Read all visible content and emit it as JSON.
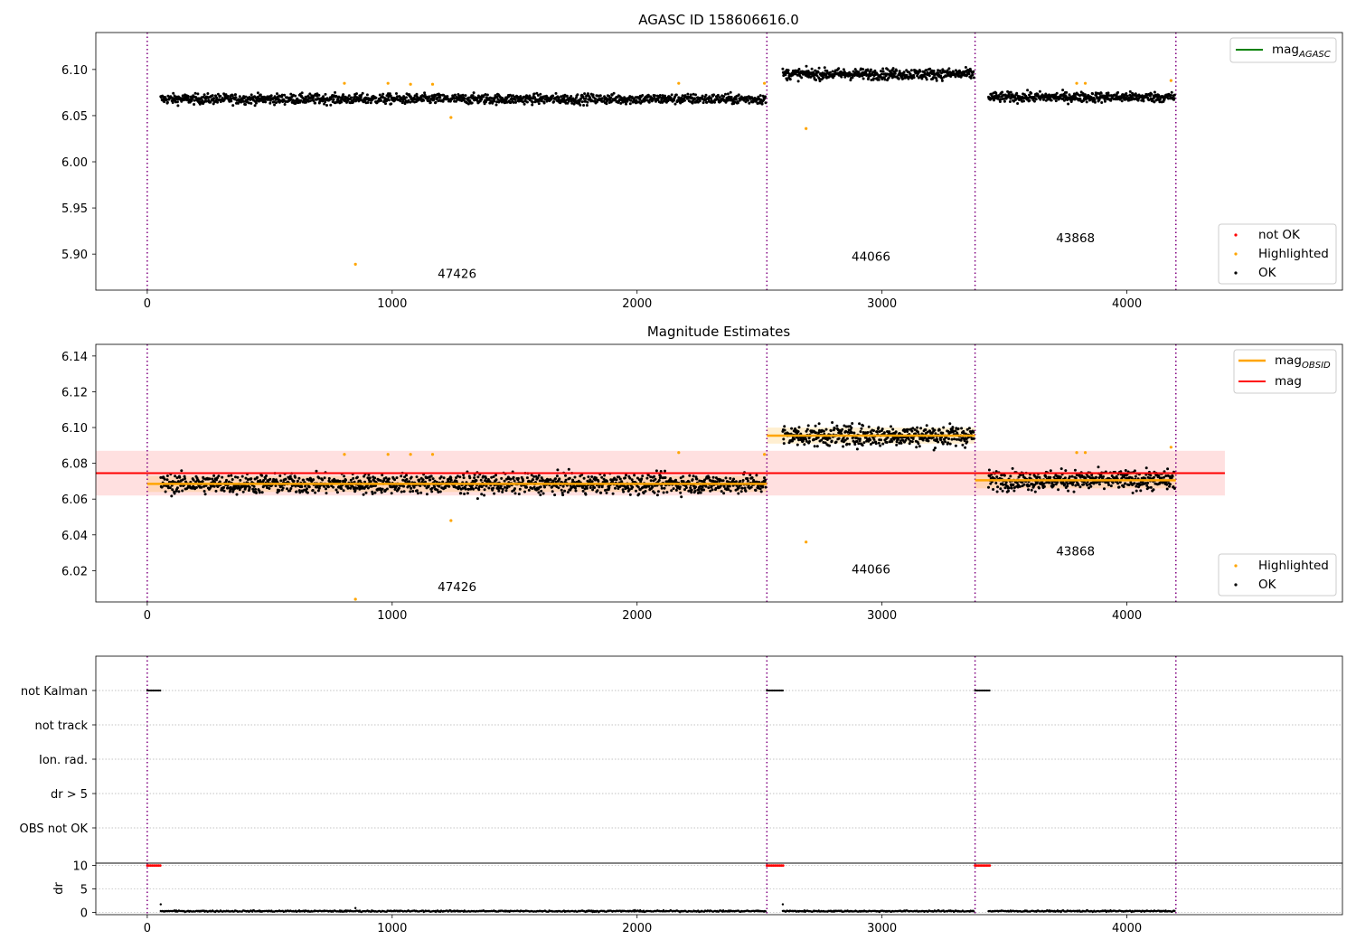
{
  "chart_data": [
    {
      "type": "scatter",
      "title": "AGASC ID 158606616.0",
      "xlim": [
        -210,
        4880
      ],
      "ylim": [
        5.861,
        6.14
      ],
      "xticks": [
        "0",
        "1000",
        "2000",
        "3000",
        "4000"
      ],
      "yticks": [
        "5.90",
        "5.95",
        "6.00",
        "6.05",
        "6.10"
      ],
      "obsid_boundaries": [
        0,
        2530,
        3380,
        4200
      ],
      "obsid_labels": [
        {
          "text": "47426",
          "x": 1265,
          "y": 5.874
        },
        {
          "text": "44066",
          "x": 2955,
          "y": 5.893
        },
        {
          "text": "43868",
          "x": 3790,
          "y": 5.913
        }
      ],
      "series": [
        {
          "name": "OK",
          "color": "#000000",
          "segments": [
            {
              "x_start": 55,
              "x_end": 2525,
              "mean": 6.068,
              "spread": 0.012,
              "n": 1400
            },
            {
              "x_start": 2595,
              "x_end": 3375,
              "mean": 6.095,
              "spread": 0.013,
              "n": 480
            },
            {
              "x_start": 3435,
              "x_end": 4195,
              "mean": 6.07,
              "spread": 0.012,
              "n": 450
            }
          ]
        },
        {
          "name": "Highlighted",
          "color": "#ffa500",
          "points": [
            [
              805,
              6.085
            ],
            [
              850,
              5.889
            ],
            [
              983,
              6.085
            ],
            [
              1075,
              6.084
            ],
            [
              1165,
              6.084
            ],
            [
              1240,
              6.048
            ],
            [
              2170,
              6.085
            ],
            [
              2520,
              6.085
            ],
            [
              2690,
              6.036
            ],
            [
              3795,
              6.085
            ],
            [
              3830,
              6.085
            ],
            [
              4180,
              6.088
            ]
          ]
        },
        {
          "name": "not OK",
          "color": "#ff0000",
          "points": []
        },
        {
          "name": "mag_{AGASC}",
          "color": "#008000",
          "value": null
        }
      ],
      "legends": [
        {
          "placement": "upper-right",
          "entries": [
            "mag_{AGASC}"
          ]
        },
        {
          "placement": "lower-right",
          "entries": [
            "not OK",
            "Highlighted",
            "OK"
          ]
        }
      ]
    },
    {
      "type": "scatter",
      "title": "Magnitude Estimates",
      "xlim": [
        -210,
        4880
      ],
      "ylim": [
        6.0025,
        6.1465
      ],
      "xticks": [
        "0",
        "1000",
        "2000",
        "3000",
        "4000"
      ],
      "yticks": [
        "6.02",
        "6.04",
        "6.06",
        "6.08",
        "6.10",
        "6.12",
        "6.14"
      ],
      "mag": {
        "value": 6.0745,
        "band": [
          6.062,
          6.087
        ],
        "x_range": [
          -210,
          4400
        ]
      },
      "mag_obsid": [
        {
          "x_start": 0,
          "x_end": 2530,
          "value": 6.0685,
          "band": [
            6.064,
            6.073
          ]
        },
        {
          "x_start": 2530,
          "x_end": 3380,
          "value": 6.0955,
          "band": [
            6.091,
            6.1
          ]
        },
        {
          "x_start": 3380,
          "x_end": 4200,
          "value": 6.0705,
          "band": [
            6.066,
            6.075
          ]
        }
      ],
      "obsid_boundaries": [
        0,
        2530,
        3380,
        4200
      ],
      "obsid_labels": [
        {
          "text": "47426",
          "x": 1265,
          "y": 6.0085
        },
        {
          "text": "44066",
          "x": 2955,
          "y": 6.0185
        },
        {
          "text": "43868",
          "x": 3790,
          "y": 6.0285
        }
      ],
      "series": [
        {
          "name": "OK",
          "color": "#000000",
          "segments": [
            {
              "x_start": 55,
              "x_end": 2525,
              "mean": 6.0685,
              "spread": 0.012,
              "n": 1400
            },
            {
              "x_start": 2595,
              "x_end": 3375,
              "mean": 6.0955,
              "spread": 0.013,
              "n": 480
            },
            {
              "x_start": 3435,
              "x_end": 4195,
              "mean": 6.0705,
              "spread": 0.012,
              "n": 450
            }
          ]
        },
        {
          "name": "Highlighted",
          "color": "#ffa500",
          "points": [
            [
              805,
              6.085
            ],
            [
              850,
              6.004
            ],
            [
              983,
              6.085
            ],
            [
              1075,
              6.085
            ],
            [
              1165,
              6.085
            ],
            [
              1240,
              6.048
            ],
            [
              2170,
              6.086
            ],
            [
              2520,
              6.085
            ],
            [
              2690,
              6.036
            ],
            [
              3795,
              6.086
            ],
            [
              3830,
              6.086
            ],
            [
              4180,
              6.089
            ]
          ]
        },
        {
          "name": "mag_{OBSID}",
          "color": "#ffa500"
        },
        {
          "name": "mag",
          "color": "#ff0000"
        }
      ],
      "legends": [
        {
          "placement": "upper-right",
          "entries": [
            "mag_{OBSID}",
            "mag"
          ]
        },
        {
          "placement": "lower-right",
          "entries": [
            "Highlighted",
            "OK"
          ]
        }
      ]
    },
    {
      "type": "scatter",
      "title": "",
      "xlim": [
        -210,
        4880
      ],
      "flag_labels": [
        "not Kalman",
        "not track",
        "Ion. rad.",
        "dr > 5",
        "OBS not OK"
      ],
      "flag_segments": [
        {
          "flag": "not Kalman",
          "x_start": 0,
          "x_end": 55
        },
        {
          "flag": "not Kalman",
          "x_start": 2530,
          "x_end": 2600
        },
        {
          "flag": "not Kalman",
          "x_start": 3380,
          "x_end": 3440
        }
      ],
      "obsid_boundaries": [
        0,
        2530,
        3380,
        4200
      ]
    },
    {
      "type": "scatter",
      "title": "",
      "xlim": [
        -210,
        4880
      ],
      "ylim": [
        -0.5,
        10.5
      ],
      "ylabel": "dr",
      "xticks": [
        "0",
        "1000",
        "2000",
        "3000",
        "4000"
      ],
      "yticks": [
        "0",
        "5",
        "10"
      ],
      "obsid_boundaries": [
        0,
        2530,
        3380,
        4200
      ],
      "series": [
        {
          "name": "dr",
          "color": "#000000",
          "segments": [
            {
              "x_start": 55,
              "x_end": 2525,
              "mean": 0.25,
              "spread": 0.15,
              "n": 700
            },
            {
              "x_start": 2595,
              "x_end": 3375,
              "mean": 0.25,
              "spread": 0.15,
              "n": 240
            },
            {
              "x_start": 3435,
              "x_end": 4195,
              "mean": 0.25,
              "spread": 0.15,
              "n": 230
            }
          ],
          "points": [
            [
              55,
              1.7
            ],
            [
              2595,
              1.7
            ],
            [
              850,
              0.9
            ]
          ]
        },
        {
          "name": "dr > 10",
          "color": "#ff0000",
          "segments": [
            {
              "x_start": 0,
              "x_end": 55,
              "value": 10
            },
            {
              "x_start": 2530,
              "x_end": 2600,
              "value": 10
            },
            {
              "x_start": 3380,
              "x_end": 3440,
              "value": 10
            }
          ]
        }
      ]
    }
  ],
  "colors": {
    "ok": "#000000",
    "highlighted": "#ffa500",
    "not_ok": "#ff0000",
    "agasc": "#008000",
    "boundary": "#800080",
    "mag": "#ff0000",
    "mag_band": "#ffe0e0"
  }
}
